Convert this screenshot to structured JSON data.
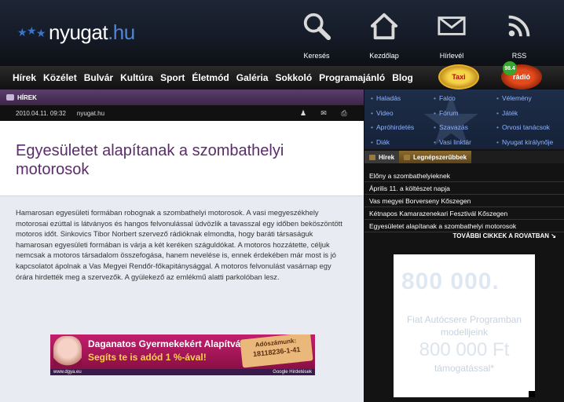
{
  "header": {
    "logo_text": "nyugat",
    "logo_tld": ".hu",
    "icons": [
      {
        "label": "Keresés",
        "icon": "search-icon"
      },
      {
        "label": "Kezdőlap",
        "icon": "home-icon"
      },
      {
        "label": "Hírlevél",
        "icon": "envelope-icon"
      },
      {
        "label": "RSS",
        "icon": "rss-icon"
      }
    ]
  },
  "nav": {
    "items": [
      "Hírek",
      "Közélet",
      "Bulvár",
      "Kultúra",
      "Sport",
      "Életmód",
      "Galéria",
      "Sokkoló",
      "Programajánló",
      "Blog"
    ],
    "badge_taxi": "Taxi",
    "badge_radio": "rádió",
    "badge_radio_num": "98.4"
  },
  "article": {
    "section": "HÍREK",
    "date": "2010.04.11. 09:32",
    "site": "nyugat.hu",
    "title": "Egyesületet alapítanak a szombathelyi motorosok",
    "body": "Hamarosan egyesületi formában robognak a szombathelyi motorosok. A vasi megyeszékhely motorosai ezúttal is látványos és hangos felvonulással üdvözlik a tavasszal egy időben beköszöntött motoros időt. Sinkovics Tibor Norbert szervező rádióknak elmondta, hogy baráti társaságuk hamarosan egyesületi formában is várja a két keréken száguldókat. A motoros hozzátette, céljuk nemcsak a motoros társadalom összefogása, hanem nevelése is, ennek érdekében már most is jó kapcsolatot ápolnak a Vas Megyei Rendőr-főkapitánysággal. A motoros felvonulást vasárnap egy órára hirdették meg a szervezők. A gyülekező az emlékmű alatti parkolóban lesz."
  },
  "ad_banner": {
    "line1": "Daganatos Gyermekekért Alapítvány",
    "line2": "Segíts te is adód 1 %-ával!",
    "tag_label": "Adószámunk:",
    "tag_number": "18118236-1-41",
    "footer_left": "www.dgya.eu",
    "footer_right": "Google Hirdetések"
  },
  "sidebar": {
    "links": [
      "Haladás",
      "Falco",
      "Vélemény",
      "Video",
      "Fórum",
      "Játék",
      "Apróhirdetés",
      "Szavazás",
      "Orvosi tanácsok",
      "Diák",
      "Vasi linktár",
      "Nyugat királynője"
    ],
    "tab_news": "Hírek",
    "tab_popular": "Legnépszerűbbek",
    "news": [
      "Előny a szombathelyieknek",
      "Április 11. a költészet napja",
      "Vas megyei Borverseny Kőszegen",
      "Kétnapos Kamarazenekari Fesztivál Kőszegen",
      "Egyesületet alapítanak a szombathelyi motorosok"
    ],
    "more": "TOVÁBBI CIKKEK A ROVATBAN"
  },
  "ad_side": {
    "big1": "800 000.",
    "line1": "Fiat Autócsere Programban",
    "line2": "modelljeink",
    "big2": "800 000 Ft",
    "line3": "támogatással*"
  }
}
